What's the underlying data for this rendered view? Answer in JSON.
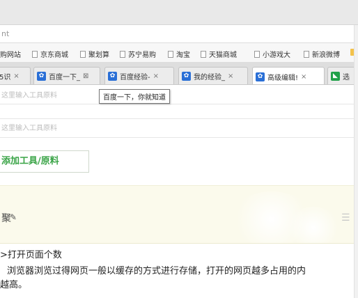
{
  "address": {
    "text": "nt"
  },
  "bookmarks": [
    {
      "label": "购网站"
    },
    {
      "label": "京东商城"
    },
    {
      "label": "聚划算"
    },
    {
      "label": "苏宁易购"
    },
    {
      "label": "淘宝"
    },
    {
      "label": "天猫商城"
    },
    {
      "label": "小游戏大"
    },
    {
      "label": "新浪微博"
    }
  ],
  "tabs": [
    {
      "label": "5识",
      "close": "×"
    },
    {
      "label": "百度一下_",
      "close": "⊠"
    },
    {
      "label": "百度经验-",
      "close": "×"
    },
    {
      "label": "我的经验_",
      "close": "×"
    },
    {
      "label": "高级编辑!",
      "close": "×"
    },
    {
      "label": "选"
    }
  ],
  "tooltip": {
    "text": "百度一下，你就知道"
  },
  "fields": {
    "tools_placeholder_1": "这里输入工具原料",
    "tools_placeholder_2": "这里输入工具原料"
  },
  "add_button": {
    "label": "添加工具/原料"
  },
  "banner": {
    "edit_text": "聚"
  },
  "article": {
    "heading": ">打开页面个数",
    "line1": "浏览器浏览过得网页一般以缓存的方式进行存储，打开的网页越多占用的内",
    "line2": "越高。"
  }
}
